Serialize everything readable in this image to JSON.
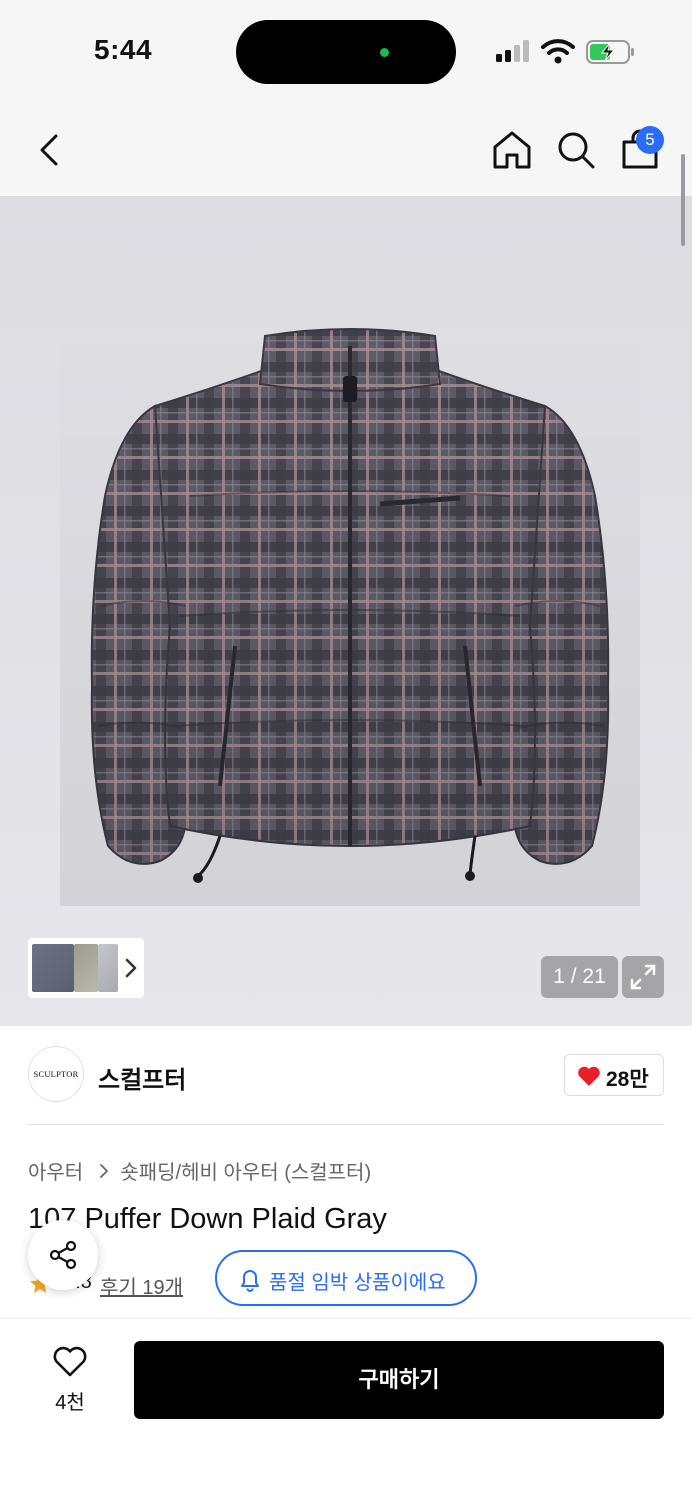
{
  "status_bar": {
    "time": "5:44"
  },
  "nav": {
    "back_icon": "chevron-left-icon",
    "home_icon": "home-icon",
    "search_icon": "search-icon",
    "bag_icon": "shopping-bag-icon",
    "cart_count": "5"
  },
  "gallery": {
    "counter": "1 / 21",
    "expand_icon": "expand-icon"
  },
  "brand": {
    "logo_text": "SCULPTOR",
    "name": "스컬프터",
    "like_count": "28만"
  },
  "product": {
    "breadcrumb": [
      "아우터",
      "숏패딩/헤비 아우터 (스컬프터)"
    ],
    "title": "107 Puffer Down Plaid Gray",
    "rating": "4.8",
    "review_link": "후기 19개",
    "soldout_notice": "품절 임박 상품이에요"
  },
  "bottom_bar": {
    "wish_count": "4천",
    "buy_label": "구매하기"
  },
  "colors": {
    "accent_blue": "#2a6cf6",
    "heart_red": "#e8202a",
    "buy_button": "#000000"
  }
}
